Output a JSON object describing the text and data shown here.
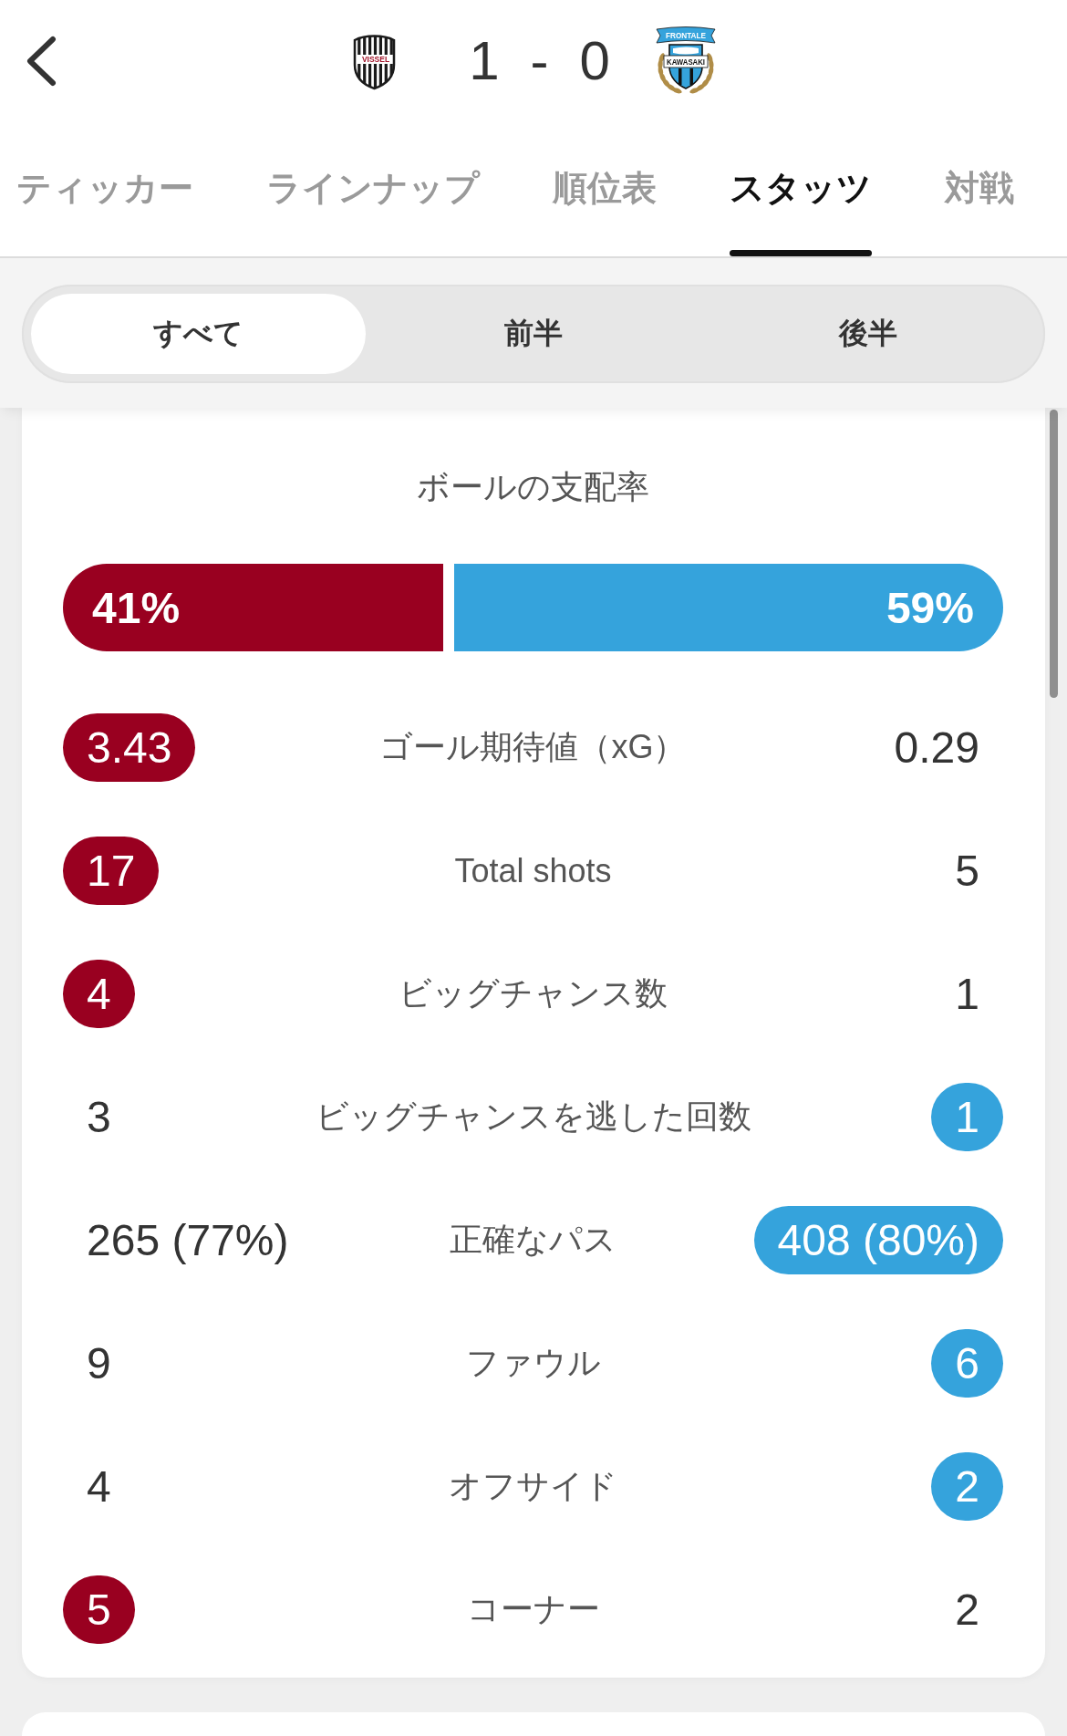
{
  "match": {
    "home": {
      "score": "1",
      "crest_text": [
        "VISSEL"
      ]
    },
    "separator": "-",
    "away": {
      "score": "0",
      "crest_text": [
        "FRONTALE",
        "KAWASAKI"
      ]
    }
  },
  "tabs": [
    {
      "label": "ティッカー",
      "selected": false
    },
    {
      "label": "ラインナップ",
      "selected": false
    },
    {
      "label": "順位表",
      "selected": false
    },
    {
      "label": "スタッツ",
      "selected": true
    },
    {
      "label": "対戦",
      "selected": false
    }
  ],
  "period_tabs": [
    {
      "label": "すべて",
      "selected": true
    },
    {
      "label": "前半",
      "selected": false
    },
    {
      "label": "後半",
      "selected": false
    }
  ],
  "possession": {
    "title": "ボールの支配率",
    "home": {
      "value": "41%",
      "level": 0.41
    },
    "away": {
      "value": "59%",
      "level": 0.59
    }
  },
  "stats": [
    {
      "label": "ゴール期待値（xG）",
      "home": {
        "value": "3.43",
        "highlighted": true
      },
      "away": {
        "value": "0.29",
        "highlighted": false
      }
    },
    {
      "label": "Total shots",
      "home": {
        "value": "17",
        "highlighted": true
      },
      "away": {
        "value": "5",
        "highlighted": false
      }
    },
    {
      "label": "ビッグチャンス数",
      "home": {
        "value": "4",
        "highlighted": true
      },
      "away": {
        "value": "1",
        "highlighted": false
      }
    },
    {
      "label": "ビッグチャンスを逃した回数",
      "home": {
        "value": "3",
        "highlighted": false
      },
      "away": {
        "value": "1",
        "highlighted": true
      }
    },
    {
      "label": "正確なパス",
      "home": {
        "value": "265 (77%)",
        "highlighted": false
      },
      "away": {
        "value": "408 (80%)",
        "highlighted": true
      }
    },
    {
      "label": "ファウル",
      "home": {
        "value": "9",
        "highlighted": false
      },
      "away": {
        "value": "6",
        "highlighted": true
      }
    },
    {
      "label": "オフサイド",
      "home": {
        "value": "4",
        "highlighted": false
      },
      "away": {
        "value": "2",
        "highlighted": true
      }
    },
    {
      "label": "コーナー",
      "home": {
        "value": "5",
        "highlighted": true
      },
      "away": {
        "value": "2",
        "highlighted": false
      }
    }
  ]
}
